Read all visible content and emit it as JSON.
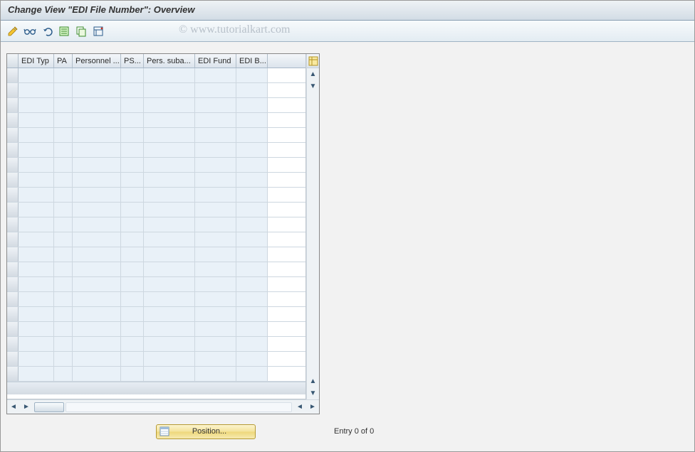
{
  "title": "Change View \"EDI File Number\": Overview",
  "watermark": "© www.tutorialkart.com",
  "toolbar_icons": [
    "edit-icon",
    "glasses-icon",
    "undo-icon",
    "new-entries-icon",
    "copy-entry-icon",
    "delete-entry-icon"
  ],
  "table": {
    "columns": [
      "EDI Typ",
      "PA",
      "Personnel ...",
      "PS...",
      "Pers. suba...",
      "EDI Fund",
      "EDI B..."
    ],
    "rows": 21
  },
  "footer": {
    "position_label": "Position...",
    "entry_text": "Entry 0 of 0"
  }
}
